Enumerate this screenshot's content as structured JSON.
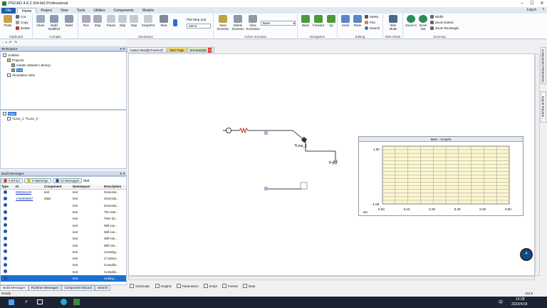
{
  "window": {
    "title": "PSCAD 4.6.2 (64-bit) Professional"
  },
  "menu": {
    "file": "File",
    "tabs": [
      "Home",
      "Project",
      "View",
      "Tools",
      "Utilities",
      "Components",
      "Models"
    ],
    "login": "Log in"
  },
  "ribbon": {
    "clipboard": {
      "paste": "Paste",
      "cut": "Cut",
      "copy": "Copy",
      "delete": "Delete",
      "label": "Clipboard"
    },
    "compile": {
      "clean": "Clean",
      "build_modified": "Build Modified",
      "build": "Build",
      "label": "Compile"
    },
    "simulation": {
      "run": "Run",
      "stop": "Stop",
      "pause": "Pause",
      "skip": "Skip",
      "step": "Step",
      "snapshot": "Snapshot",
      "slow": "Slow",
      "plot_step_label": "Plot Step (us)",
      "plot_step_value": "250.0",
      "label": "Simulation"
    },
    "active_scenario": {
      "save": "Save Scenario",
      "delete": "Delete Scenario",
      "view": "View Scenarios",
      "selected": "Base",
      "label": "Active Scenario"
    },
    "navigation": {
      "back": "Back",
      "forward": "Forward",
      "up": "Up",
      "label": "Navigation"
    },
    "editing": {
      "undo": "Undo",
      "redo": "Redo",
      "select": "Select",
      "pan": "Pan",
      "search": "Search",
      "label": "Editing"
    },
    "wire_mode": {
      "wire": "Wire Mode",
      "label": "Wire Mode"
    },
    "zooming": {
      "zoom_in": "Zoom In",
      "zoom_out": "Zoom Out",
      "width": "Width",
      "extent": "Zoom Extent",
      "rectangle": "Zoom Rectangle",
      "label": "Zooming"
    }
  },
  "workspace": {
    "header": "Workspace",
    "tree": [
      "Untitled",
      "Projects",
      "master (Master Library)",
      "test",
      "Simulation Sets"
    ]
  },
  "hierarchy": {
    "root": "Main",
    "child": "TLine_1 \"TLine_1\""
  },
  "build_messages": {
    "header": "Build Messages",
    "errors": "0 Errors",
    "warnings": "0 Warnings",
    "messages": "14 Messages",
    "filter": "test",
    "columns": [
      "Type",
      "Id",
      "Component",
      "Namespace",
      "Description"
    ],
    "rows": [
      {
        "id": "899538128",
        "component": "test",
        "namespace": "test",
        "desc": "Generati..."
      },
      {
        "id": "1765999687",
        "component": "Main",
        "namespace": "test",
        "desc": "Generati..."
      },
      {
        "id": "",
        "component": "",
        "namespace": "test",
        "desc": "Generati..."
      },
      {
        "id": "",
        "component": "",
        "namespace": "test",
        "desc": "The tota..."
      },
      {
        "id": "",
        "component": "",
        "namespace": "test",
        "desc": "Time for..."
      },
      {
        "id": "",
        "component": "",
        "namespace": "test",
        "desc": "Will exe..."
      },
      {
        "id": "",
        "component": "",
        "namespace": "test",
        "desc": "Will exe..."
      },
      {
        "id": "",
        "component": "",
        "namespace": "test",
        "desc": "Will exe..."
      },
      {
        "id": "",
        "component": "",
        "namespace": "test",
        "desc": "Will exe..."
      },
      {
        "id": "",
        "component": "",
        "namespace": "test",
        "desc": "Creating..."
      },
      {
        "id": "",
        "component": "",
        "namespace": "test",
        "desc": "C:\\Users..."
      },
      {
        "id": "",
        "component": "",
        "namespace": "test",
        "desc": "Compilin..."
      },
      {
        "id": "",
        "component": "",
        "namespace": "test",
        "desc": "Compilin..."
      },
      {
        "id": "",
        "component": "",
        "namespace": "test",
        "desc": "Linking ..."
      }
    ]
  },
  "bottom_tabs": [
    "Build Messages",
    "Runtime Messages",
    "Component Wizard",
    "Search"
  ],
  "doc_tabs": [
    "master:Main[B:Passive]*",
    "Start Page",
    "test:Main[B]"
  ],
  "side_tabs": [
    "Component Parameters",
    "Import Reports"
  ],
  "canvas_tabs": [
    "Schematic",
    "Graphic",
    "Parameters",
    "Script",
    "Fortran",
    "Data"
  ],
  "schematic": {
    "label_tline": "TLine_1",
    "label_p": "P+jQ"
  },
  "graph": {
    "title": "Main : Graphs",
    "ymax": "1.00",
    "ymin": "-1.00",
    "xlabel": "sec",
    "xticks": [
      "0.00",
      "0.10",
      "0.20",
      "0.30",
      "0.40",
      "0.50"
    ]
  },
  "badge": {
    "text": "4"
  },
  "status": {
    "left": "Ready",
    "right": "116.5"
  },
  "taskbar": {
    "time": "14:28",
    "date": "2023/4/18",
    "lang": "中"
  }
}
